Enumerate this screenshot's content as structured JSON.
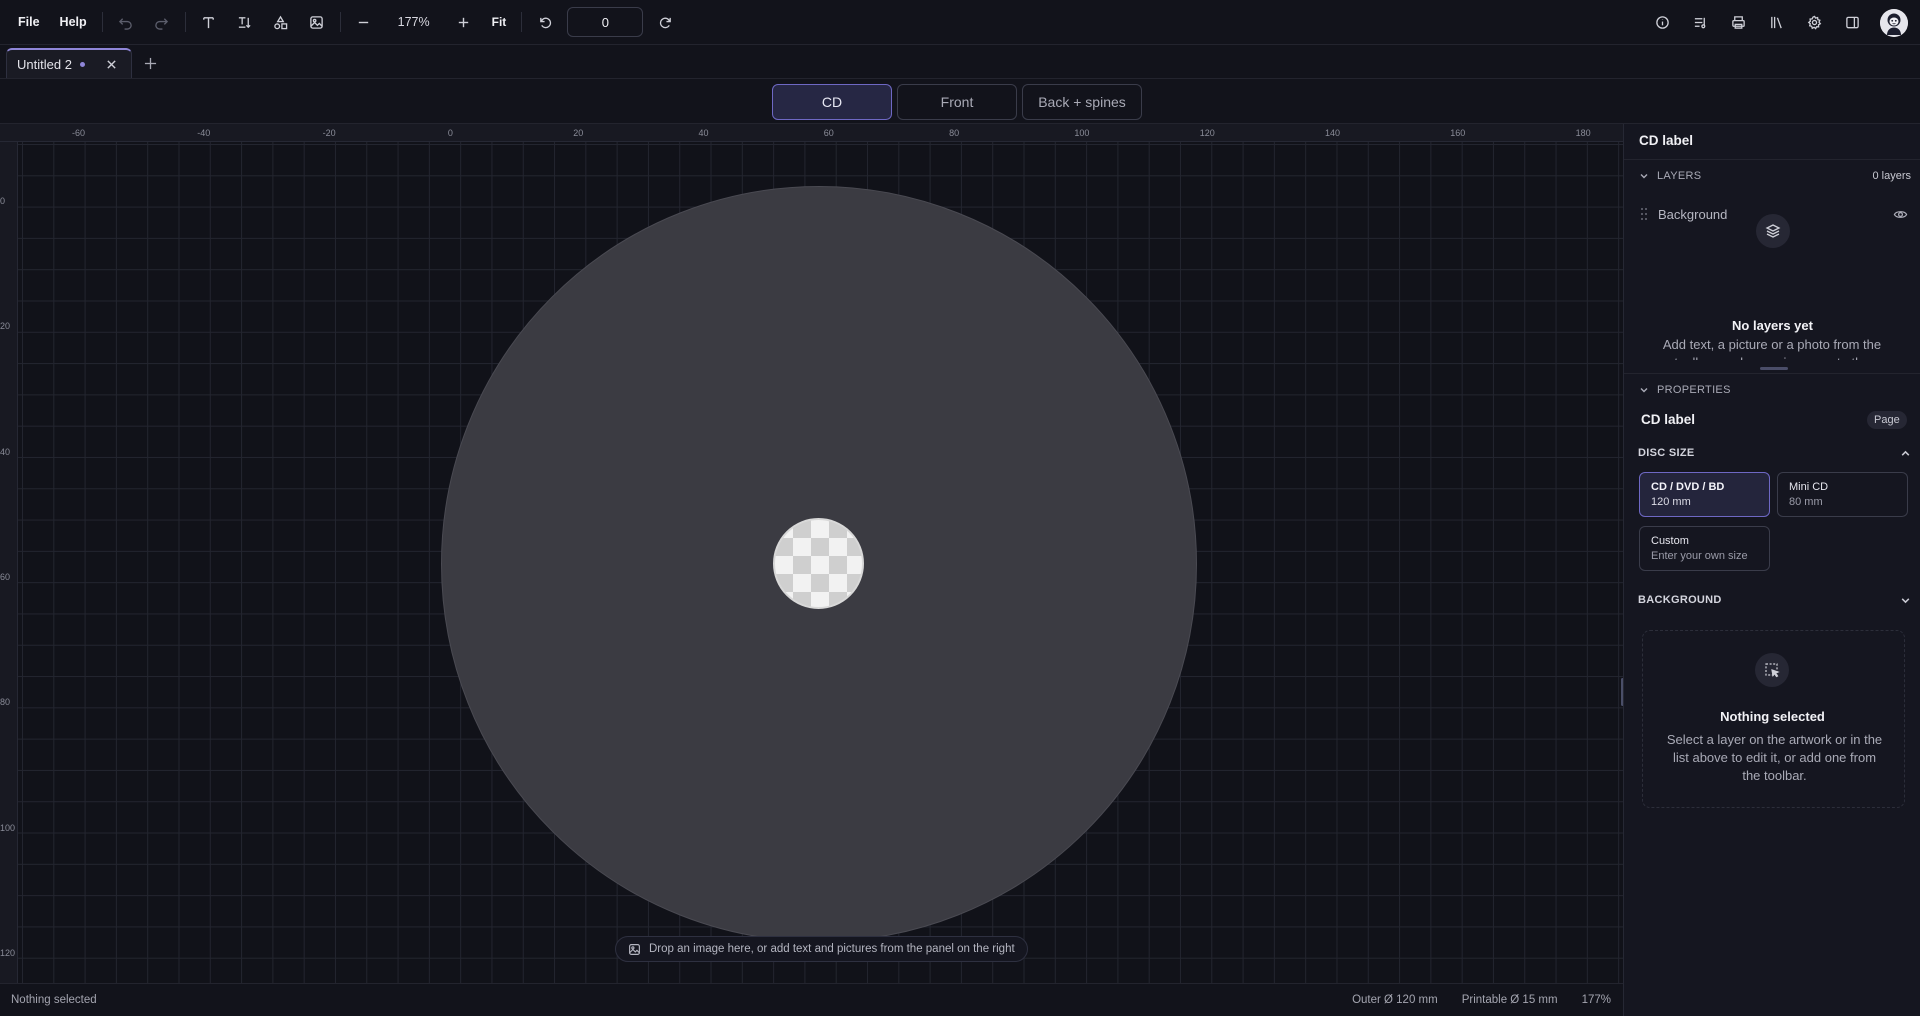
{
  "toolbar": {
    "file_label": "File",
    "help_label": "Help",
    "zoom_value": "177%",
    "fit_label": "Fit",
    "rotation_value": "0"
  },
  "tabs": {
    "doc_tab_label": "Untitled 2"
  },
  "views": [
    "CD",
    "Front",
    "Back + spines"
  ],
  "ruler": {
    "top_ticks": [
      "-60",
      "-40",
      "-20",
      "0",
      "20",
      "40",
      "60",
      "80",
      "100",
      "120",
      "140",
      "160",
      "180"
    ],
    "left_ticks": [
      "0",
      "20",
      "40",
      "60",
      "80",
      "100",
      "120"
    ]
  },
  "canvas": {
    "hint": "Drop an image here, or add text and pictures from the panel on the right"
  },
  "status": {
    "selection": "Nothing selected",
    "outer": "Outer Ø 120 mm",
    "printable": "Printable Ø 15 mm",
    "zoom": "177%"
  },
  "panel": {
    "title": "CD label",
    "layers": {
      "header": "LAYERS",
      "count": "0 layers",
      "background_layer": "Background",
      "empty_title": "No layers yet",
      "empty_text": "Add text, a picture or a photo from the toolbar, or drop an image onto the"
    },
    "properties": {
      "header": "PROPERTIES",
      "title": "CD label",
      "badge": "Page",
      "disc_size_label": "DISC SIZE",
      "options": [
        {
          "name": "CD / DVD / BD",
          "sub": "120 mm"
        },
        {
          "name": "Mini CD",
          "sub": "80 mm"
        },
        {
          "name": "Custom",
          "sub": "Enter your own size"
        }
      ],
      "background_label": "BACKGROUND",
      "nothing_title": "Nothing selected",
      "nothing_text": "Select a layer on the artwork or in the list above to edit it, or add one from the toolbar."
    }
  },
  "colors": {
    "accent": "#8f86d8",
    "disc": "#3b3b42",
    "background": "#12131b"
  },
  "icons": [
    "undo-icon",
    "redo-icon",
    "text-icon",
    "text-path-icon",
    "shapes-icon",
    "image-icon",
    "zoom-out-icon",
    "zoom-in-icon",
    "rotate-left-icon",
    "rotate-right-icon",
    "info-icon",
    "tracklist-icon",
    "print-icon",
    "library-icon",
    "settings-icon",
    "panel-toggle-icon",
    "avatar-icon",
    "close-icon",
    "plus-icon",
    "chevron-down-icon",
    "drag-handle-icon",
    "eye-icon",
    "layers-icon",
    "chevron-up-icon",
    "selection-icon"
  ]
}
